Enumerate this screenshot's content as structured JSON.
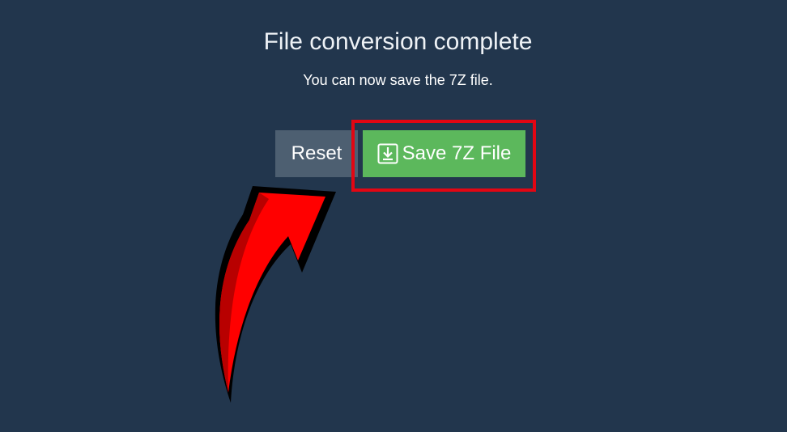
{
  "dialog": {
    "title": "File conversion complete",
    "subtitle": "You can now save the 7Z file."
  },
  "buttons": {
    "reset_label": "Reset",
    "save_label": "Save 7Z File",
    "save_icon": "download-icon"
  },
  "annotation": {
    "highlight_color": "#e30613",
    "arrow_color": "#ff0000"
  },
  "colors": {
    "background": "#22364d",
    "reset_button": "#4d5f71",
    "save_button": "#5cb85c"
  }
}
